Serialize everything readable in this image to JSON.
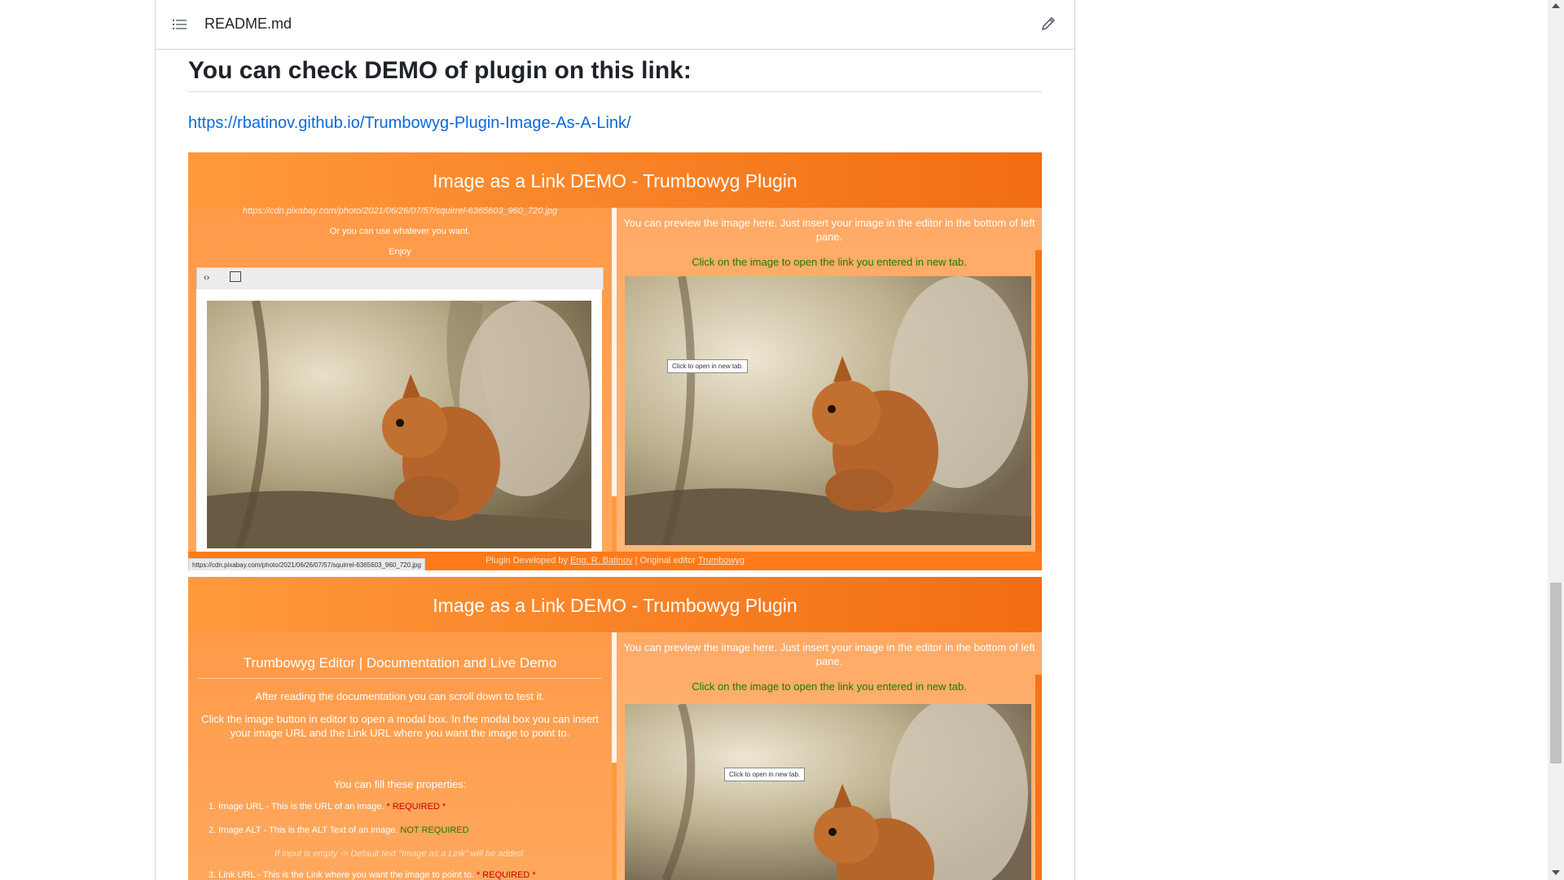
{
  "readme": {
    "filename": "README.md",
    "toc_icon": "list-unordered-icon",
    "edit_icon": "pencil-icon"
  },
  "content": {
    "heading": "You can check DEMO of plugin on this link:",
    "link": "https://rbatinov.github.io/Trumbowyg-Plugin-Image-As-A-Link/"
  },
  "demo1": {
    "title": "Image as a Link DEMO - Trumbowyg Plugin",
    "left": {
      "url_text": "https://cdn.pixabay.com/photo/2021/06/26/07/57/squirrel-6365603_960_720.jpg",
      "or_text": "Or you can use whatever you want.",
      "enjoy_text": "Enjoy",
      "toolbar_code_icon": "code-icon",
      "toolbar_image_icon": "image-icon"
    },
    "right": {
      "preview_text": "You can preview the image here. Just insert your image in the editor in the bottom of left pane.",
      "click_text": "Click on the image to open the link you entered in new tab.",
      "tooltip": "Click to open in new tab."
    },
    "footer": {
      "prefix": "Plugin Developed by",
      "author": "Eng. R. Batinov",
      "separator": "|",
      "editor_prefix": "Original editor",
      "editor_name": "Trumbowyg"
    },
    "status_url": "https://cdn.pixabay.com/photo/2021/06/26/07/57/squirrel-6365603_960_720.jpg"
  },
  "demo2": {
    "title": "Image as a Link DEMO - Trumbowyg Plugin",
    "left": {
      "doc_title": "Trumbowyg Editor | Documentation and Live Demo",
      "after_reading": "After reading the documentation you can scroll down to test it.",
      "click_instructions": "Click the image button in editor to open a modal box. In the modal box you can insert your image URL and the Link URL where you want the image to point to.",
      "fill_properties": "You can fill these properties:",
      "prop1_label": "1. Image URL - This is the URL of an image.",
      "prop1_status": "* REQUIRED *",
      "prop2_label": "2. Image ALT - This is the ALT Text of an image.",
      "prop2_status": "NOT REQUIRED",
      "alt_note": "If input is empty -> Default text \"Image as a Link\" will be added.",
      "prop3_label": "3. Link URL - This is the Link where you want the image to point to.",
      "prop3_status": "* REQUIRED *"
    },
    "right": {
      "preview_text": "You can preview the image here. Just insert your image in the editor in the bottom of left pane.",
      "click_text": "Click on the image to open the link you entered in new tab.",
      "tooltip": "Click to open in new tab."
    }
  },
  "colors": {
    "link": "#0969da",
    "demo_orange": "#ff9a3d",
    "demo_header_dark": "#f26d12",
    "required": "#c00000",
    "not_required": "#1d7a00"
  }
}
